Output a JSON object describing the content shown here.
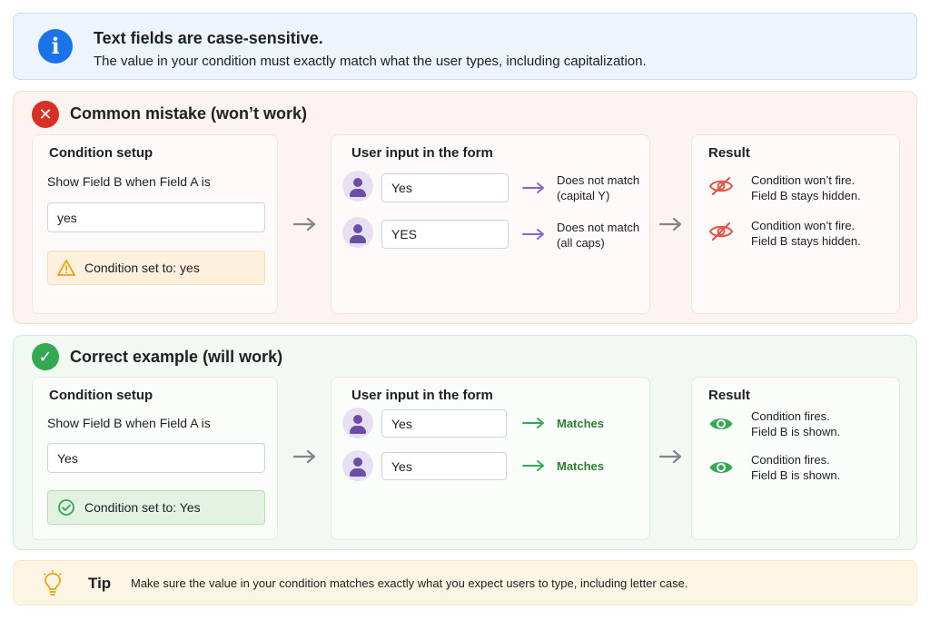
{
  "info": {
    "title": "Text fields are case-sensitive.",
    "subtitle": "The value in your condition must exactly match what the user types, including capitalization."
  },
  "mistake": {
    "title": "Common mistake (won’t work)",
    "icon": "x-mark-icon",
    "condition": {
      "title": "Condition setup",
      "label": "Show Field B when Field A is",
      "value": "yes",
      "status": "Condition set to: yes",
      "status_icon": "warning-icon"
    },
    "input": {
      "title": "User input in the form",
      "rows": [
        {
          "value": "Yes",
          "match_line1": "Does not match",
          "match_line2": "(capital Y)"
        },
        {
          "value": "YES",
          "match_line1": "Does not match",
          "match_line2": "(all caps)"
        }
      ]
    },
    "result": {
      "title": "Result",
      "rows": [
        {
          "line1": "Condition won’t fire.",
          "line2": "Field B stays hidden.",
          "icon": "eye-off-icon"
        },
        {
          "line1": "Condition won’t fire.",
          "line2": "Field B stays hidden.",
          "icon": "eye-off-icon"
        }
      ]
    }
  },
  "correct": {
    "title": "Correct example (will work)",
    "icon": "check-icon",
    "condition": {
      "title": "Condition setup",
      "label": "Show Field B when Field A is",
      "value": "Yes",
      "status": "Condition set to: Yes",
      "status_icon": "check-circle-icon"
    },
    "input": {
      "title": "User input in the form",
      "rows": [
        {
          "value": "Yes",
          "match": "Matches"
        },
        {
          "value": "Yes",
          "match": "Matches"
        }
      ]
    },
    "result": {
      "title": "Result",
      "rows": [
        {
          "line1": "Condition fires.",
          "line2": "Field B is shown.",
          "icon": "eye-icon"
        },
        {
          "line1": "Condition fires.",
          "line2": "Field B is shown.",
          "icon": "eye-icon"
        }
      ]
    }
  },
  "tip": {
    "label": "Tip",
    "text": "Make sure the value in your condition matches exactly what you expect users to type, including letter case."
  },
  "colors": {
    "info": "#1a73e8",
    "error": "#d93025",
    "success": "#34a853",
    "user_arrow_bad": "#8e63c9",
    "user_arrow_good": "#34a853",
    "warning": "#e8a317"
  }
}
